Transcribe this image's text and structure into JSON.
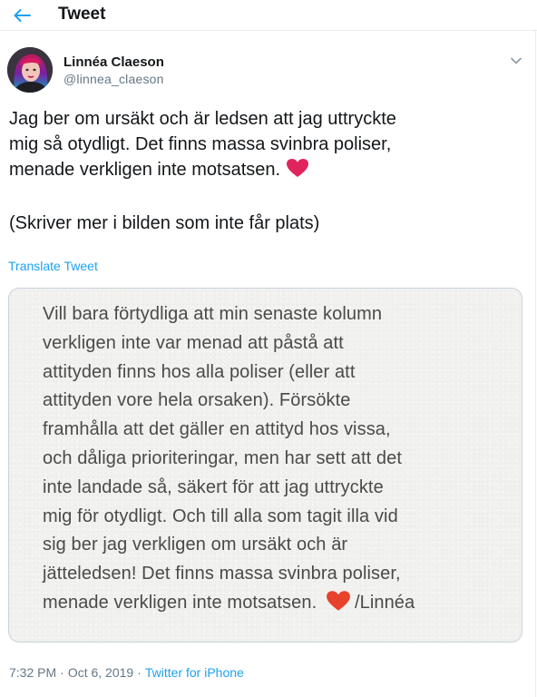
{
  "header": {
    "title": "Tweet"
  },
  "author": {
    "name": "Linnéa Claeson",
    "handle": "@linnea_claeson"
  },
  "tweet": {
    "line1": "Jag ber om ursäkt och är ledsen att jag uttryckte",
    "line2": "mig så otydligt. Det finns massa svinbra poliser,",
    "line3": "menade verkligen inte motsatsen.",
    "line4": "(Skriver mer i bilden som inte får plats)",
    "translate_label": "Translate Tweet"
  },
  "image_text": [
    "Vill bara förtydliga att min senaste kolumn",
    "verkligen inte var menad att påstå att",
    "attityden finns hos alla poliser (eller att",
    "attityden vore hela orsaken). Försökte",
    "framhålla att det gäller en attityd hos vissa,",
    "och dåliga prioriteringar, men har sett att det",
    "inte landade så, säkert för att jag uttryckte",
    "mig för otydligt. Och till alla som tagit illa vid",
    "sig ber jag verkligen om ursäkt och är",
    "jätteledsen! Det finns massa svinbra poliser,",
    "menade verkligen inte motsatsen."
  ],
  "image_signature": "/Linnéa",
  "meta": {
    "time": "7:32 PM",
    "separator": "·",
    "date": "Oct 6, 2019",
    "source": "Twitter for iPhone"
  },
  "colors": {
    "accent": "#1da1f2",
    "heart": "#e0245e",
    "secondary_text": "#657786"
  },
  "icons": {
    "back": "arrow-left-icon",
    "caret": "chevron-down-icon",
    "heart": "red-heart-emoji"
  }
}
